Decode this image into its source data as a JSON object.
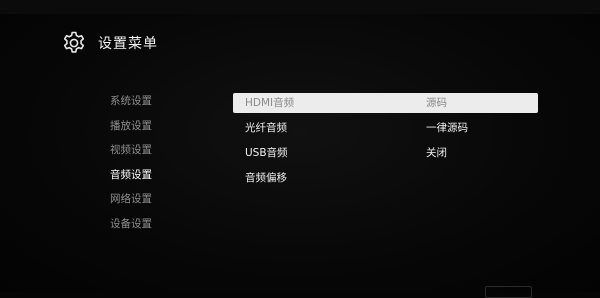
{
  "header": {
    "title": "设置菜单",
    "icon": "gear-icon"
  },
  "sidebar": {
    "items": [
      {
        "label": "系统设置"
      },
      {
        "label": "播放设置"
      },
      {
        "label": "视频设置"
      },
      {
        "label": "音频设置",
        "active": true
      },
      {
        "label": "网络设置"
      },
      {
        "label": "设备设置"
      }
    ]
  },
  "options": {
    "items": [
      {
        "label": "HDMI音频",
        "selected": true
      },
      {
        "label": "光纤音频"
      },
      {
        "label": "USB音频"
      },
      {
        "label": "音频偏移"
      }
    ]
  },
  "values": {
    "items": [
      {
        "label": "源码",
        "selected": true
      },
      {
        "label": "一律源码"
      },
      {
        "label": "关闭"
      }
    ]
  },
  "colors": {
    "background": "#050505",
    "highlight": "#ececec",
    "text": "#f2f2f2",
    "muted": "#8f8f8f"
  }
}
